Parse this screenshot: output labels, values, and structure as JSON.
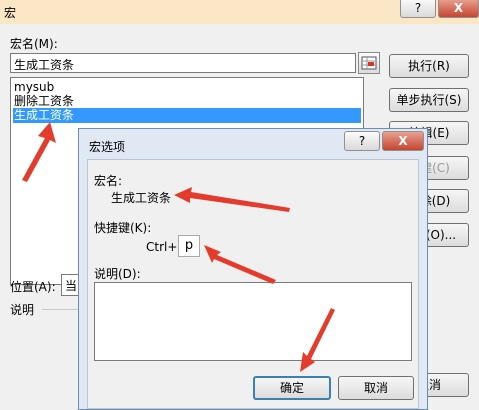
{
  "main_window": {
    "title": "宏",
    "help_btn": "?",
    "close_btn": "X",
    "macro_name_label": "宏名(M):",
    "macro_name_value": "生成工资条",
    "macro_list": [
      "mysub",
      "删除工资条",
      "生成工资条"
    ],
    "selected_index": 2,
    "buttons": {
      "run": "执行(R)",
      "step": "单步执行(S)",
      "edit": "编辑(E)",
      "create": "创建(C)",
      "delete": "删除(D)",
      "options": "选项(O)...",
      "cancel": "取消"
    },
    "location_label": "位置(A):",
    "location_value": "当",
    "description_label": "说明"
  },
  "options_dialog": {
    "title": "宏选项",
    "help_btn": "?",
    "close_btn": "X",
    "macro_name_label": "宏名:",
    "macro_name_value": "生成工资条",
    "shortcut_label": "快捷键(K):",
    "ctrl_prefix": "Ctrl+",
    "hotkey_value": "p",
    "description_label": "说明(D):",
    "description_value": "",
    "ok_button": "确定",
    "cancel_button": "取消"
  },
  "colors": {
    "titlebar": "#fbe7c6",
    "selection": "#3399ff",
    "annotation_arrow": "#e53b2c"
  }
}
